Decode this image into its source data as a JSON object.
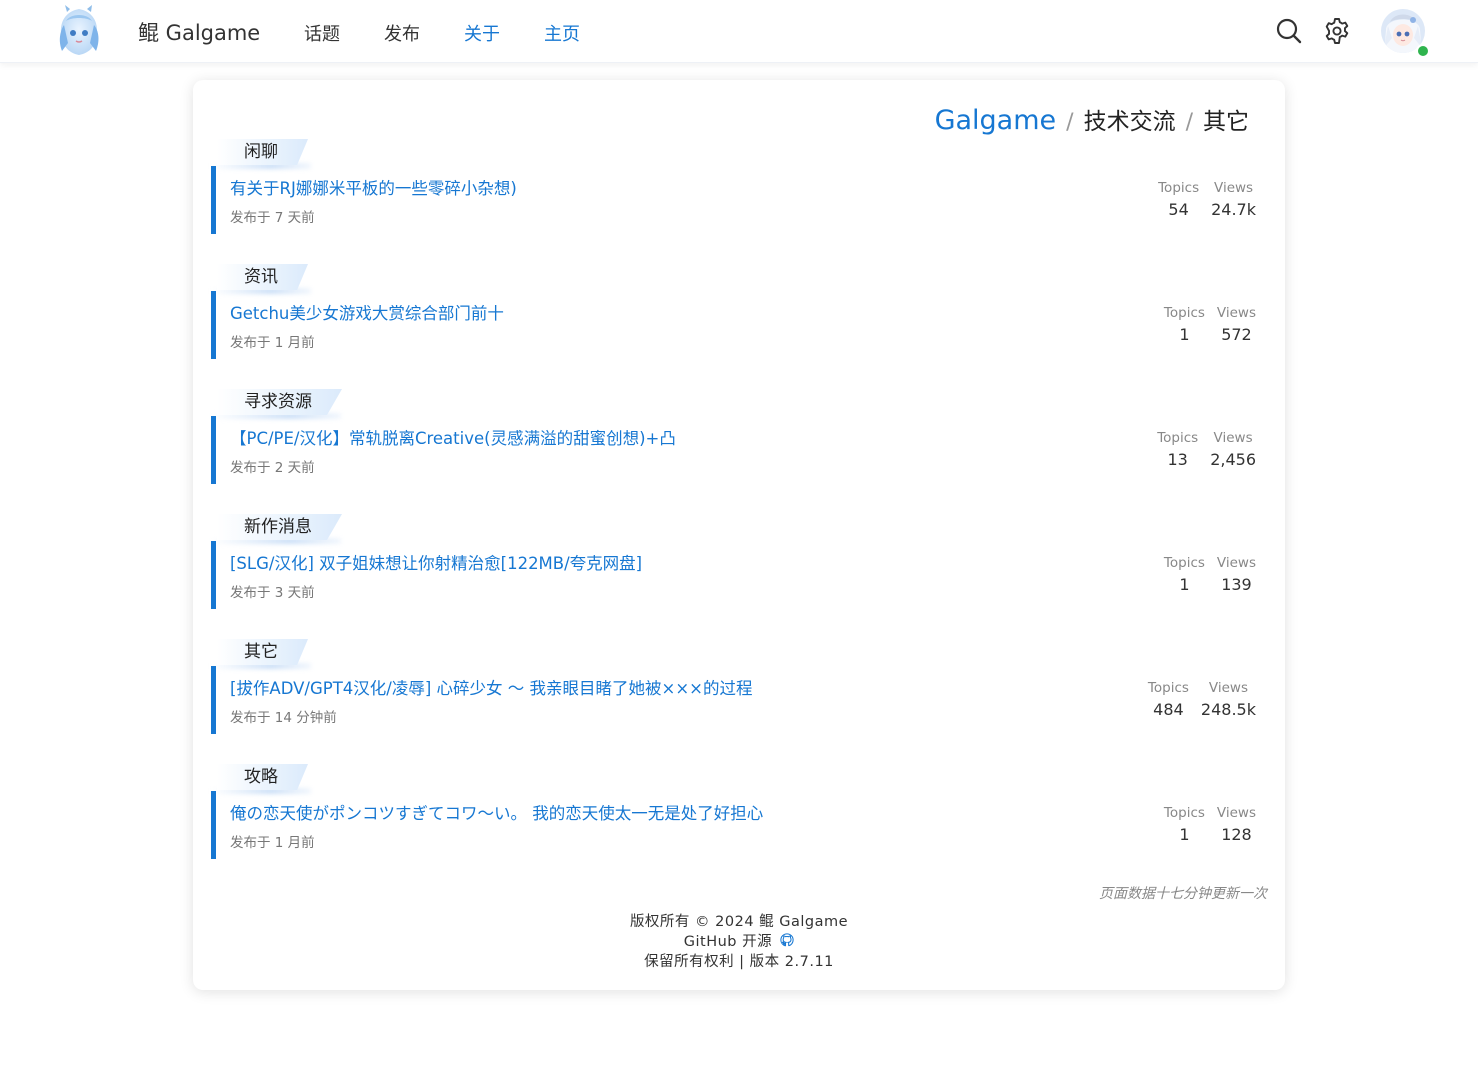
{
  "header": {
    "brand": "鲲 Galgame",
    "nav": [
      {
        "label": "话题",
        "style": "plain"
      },
      {
        "label": "发布",
        "style": "plain"
      },
      {
        "label": "关于",
        "style": "link"
      },
      {
        "label": "主页",
        "style": "link"
      }
    ],
    "icons": [
      "search-icon",
      "gear-icon"
    ],
    "online_status_color": "#2fb44e"
  },
  "breadcrumb": {
    "root": "Galgame",
    "separator": "/",
    "level1": "技术交流",
    "level2": "其它"
  },
  "categories": [
    {
      "tag": "闲聊",
      "topic": "有关于RJ娜娜米平板的一些零碎小杂想)",
      "time": "发布于 7 天前",
      "topics_label": "Topics",
      "topics": "54",
      "views_label": "Views",
      "views": "24.7k"
    },
    {
      "tag": "资讯",
      "topic": "Getchu美少女游戏大赏综合部门前十",
      "time": "发布于 1 月前",
      "topics_label": "Topics",
      "topics": "1",
      "views_label": "Views",
      "views": "572"
    },
    {
      "tag": "寻求资源",
      "topic": "【PC/PE/汉化】常轨脱离Creative(灵感满溢的甜蜜创想)+凸",
      "time": "发布于 2 天前",
      "topics_label": "Topics",
      "topics": "13",
      "views_label": "Views",
      "views": "2,456"
    },
    {
      "tag": "新作消息",
      "topic": "[SLG/汉化] 双子姐妹想让你射精治愈[122MB/夸克网盘]",
      "time": "发布于 3 天前",
      "topics_label": "Topics",
      "topics": "1",
      "views_label": "Views",
      "views": "139"
    },
    {
      "tag": "其它",
      "topic": "[拔作ADV/GPT4汉化/凌辱] 心碎少女 ～ 我亲眼目睹了她被×××的过程",
      "time": "发布于 14 分钟前",
      "topics_label": "Topics",
      "topics": "484",
      "views_label": "Views",
      "views": "248.5k"
    },
    {
      "tag": "攻略",
      "topic": "俺の恋天使がポンコツすぎてコワ～い。 我的恋天使太一无是处了好担心",
      "time": "发布于 1 月前",
      "topics_label": "Topics",
      "topics": "1",
      "views_label": "Views",
      "views": "128"
    }
  ],
  "update_note": "页面数据十七分钟更新一次",
  "footer": {
    "copyright": "版权所有 © 2024 鲲 Galgame",
    "github": "GitHub 开源",
    "rights": "保留所有权利 | 版本 2.7.11"
  },
  "colors": {
    "accent": "#1677d2",
    "text": "#333333",
    "muted": "#888888"
  }
}
